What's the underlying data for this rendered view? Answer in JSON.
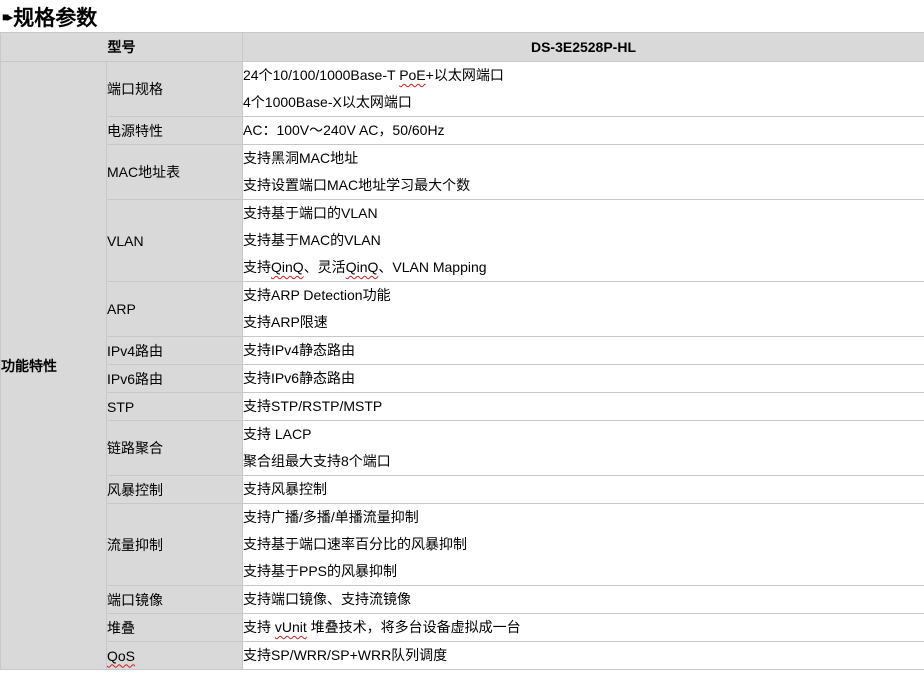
{
  "title": "规格参数",
  "header": {
    "model_label": "型号",
    "model_value": "DS-3E2528P-HL"
  },
  "category": "功能特性",
  "rows": [
    {
      "feature": "端口规格",
      "lines": [
        "24个10/100/1000Base-T PoE+以太网端口",
        "4个1000Base-X以太网端口"
      ]
    },
    {
      "feature": "电源特性",
      "lines": [
        "AC：100V～240V AC，50/60Hz"
      ]
    },
    {
      "feature": "MAC地址表",
      "lines": [
        "支持黑洞MAC地址",
        "支持设置端口MAC地址学习最大个数"
      ]
    },
    {
      "feature": "VLAN",
      "lines": [
        "支持基于端口的VLAN",
        "支持基于MAC的VLAN",
        "支持QinQ、灵活QinQ、VLAN Mapping"
      ]
    },
    {
      "feature": "ARP",
      "lines": [
        "支持ARP Detection功能",
        "支持ARP限速"
      ]
    },
    {
      "feature": "IPv4路由",
      "lines": [
        "支持IPv4静态路由"
      ]
    },
    {
      "feature": "IPv6路由",
      "lines": [
        "支持IPv6静态路由"
      ]
    },
    {
      "feature": "STP",
      "lines": [
        "支持STP/RSTP/MSTP"
      ]
    },
    {
      "feature": "链路聚合",
      "lines": [
        "支持 LACP",
        "聚合组最大支持8个端口"
      ]
    },
    {
      "feature": "风暴控制",
      "lines": [
        "支持风暴控制"
      ]
    },
    {
      "feature": "流量抑制",
      "lines": [
        "支持广播/多播/单播流量抑制",
        "支持基于端口速率百分比的风暴抑制",
        "支持基于PPS的风暴抑制"
      ]
    },
    {
      "feature": "端口镜像",
      "lines": [
        "支持端口镜像、支持流镜像"
      ]
    },
    {
      "feature": "堆叠",
      "lines": [
        "支持 vUnit 堆叠技术，将多台设备虚拟成一台"
      ]
    },
    {
      "feature": "QoS",
      "lines": [
        "支持SP/WRR/SP+WRR队列调度"
      ]
    }
  ]
}
